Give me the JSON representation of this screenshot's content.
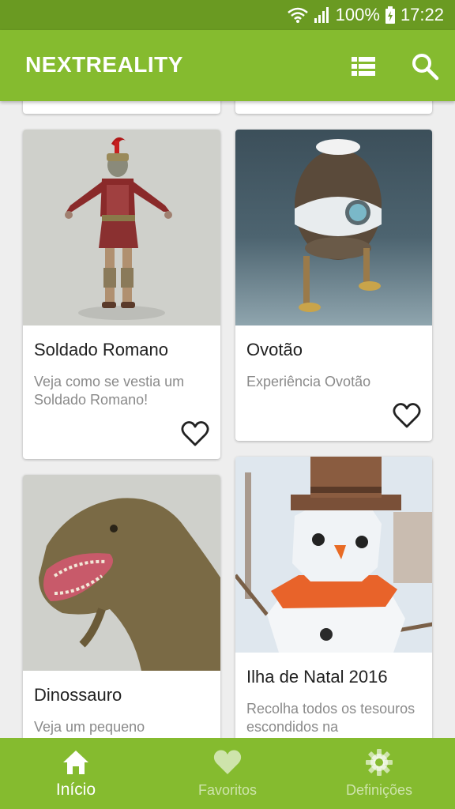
{
  "status_bar": {
    "battery": "100%",
    "time": "17:22"
  },
  "app_bar": {
    "title": "NEXTREALITY",
    "icons": [
      "view-list-icon",
      "search-icon"
    ]
  },
  "cards": [
    {
      "title": "Soldado Romano",
      "description": "Veja como se vestia um Soldado Romano!",
      "favorite": false,
      "image": "roman-soldier"
    },
    {
      "title": "Ovotão",
      "description": "Experiência Ovotão",
      "favorite": false,
      "image": "egg-robot"
    },
    {
      "title": "Dinossauro",
      "description": "Veja um pequeno",
      "image": "dinosaur"
    },
    {
      "title": "Ilha de Natal 2016",
      "description": "Recolha todos os tesouros escondidos na",
      "image": "snowman"
    }
  ],
  "bottom_nav": {
    "items": [
      {
        "label": "Início",
        "icon": "home-icon",
        "active": true
      },
      {
        "label": "Favoritos",
        "icon": "heart-icon",
        "active": false
      },
      {
        "label": "Definições",
        "icon": "gear-icon",
        "active": false
      }
    ]
  },
  "colors": {
    "primary": "#85bb2f",
    "status_bar": "#6a9a22",
    "background": "#eeeeee"
  }
}
